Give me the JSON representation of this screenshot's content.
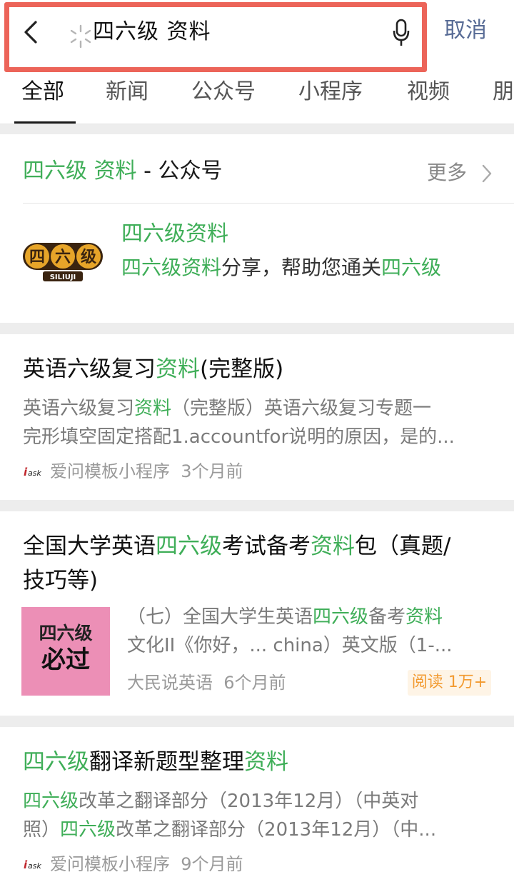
{
  "search": {
    "back_label": "返回",
    "query": "四六级 资料",
    "cancel": "取消"
  },
  "tabs": [
    {
      "label": "全部"
    },
    {
      "label": "新闻"
    },
    {
      "label": "公众号"
    },
    {
      "label": "小程序"
    },
    {
      "label": "视频"
    },
    {
      "label": "朋"
    }
  ],
  "account_section": {
    "title_hl1": "四六级",
    "title_hl2": "资料",
    "title_rest": " - 公众号",
    "more": "更多",
    "logo_text": "四六级",
    "logo_sub": "SILIUJI",
    "name": "四六级资料",
    "desc_parts": [
      "四六级资料",
      "分享，帮助您通关",
      "四六级"
    ]
  },
  "results": [
    {
      "title_parts": [
        "英语六级复习",
        "资料",
        "(完整版)"
      ],
      "body_l1_parts": [
        "英语六级复习",
        "资料",
        "（完整版）英语六级复习专题一"
      ],
      "body_l2": "完形填空固定搭配1.accountfor说明的原因，是的...",
      "source": "爱问模板小程序",
      "time": "3个月前",
      "source_icon": "iask-icon"
    },
    {
      "title_l1_parts": [
        "全国大学英语",
        "四六级",
        "考试备考",
        "资料",
        "包（真题/"
      ],
      "title_l2": "技巧等)",
      "thumb_line1": "四六级",
      "thumb_line2": "必过",
      "body_l1_parts": [
        "（七）全国大学生英语",
        "四六级",
        "备考",
        "资料"
      ],
      "body_l2": "文化II《你好，... china）英文版（1-...",
      "source": "大民说英语",
      "time": "6个月前",
      "badge": "阅读 1万+"
    },
    {
      "title_parts": [
        "四六级",
        "翻译新题型整理",
        "资料"
      ],
      "body_l1_parts": [
        "四六级",
        "改革之翻译部分（2013年12月）（中英对"
      ],
      "body_l2_parts": [
        "照）",
        "四六级",
        "改革之翻译部分（2013年12月）（中..."
      ],
      "source": "爱问模板小程序",
      "time": "9个月前",
      "source_icon": "iask-icon"
    }
  ],
  "colors": {
    "highlight": "#3fae58",
    "link": "#576b95",
    "annotation": "#ec6459"
  }
}
